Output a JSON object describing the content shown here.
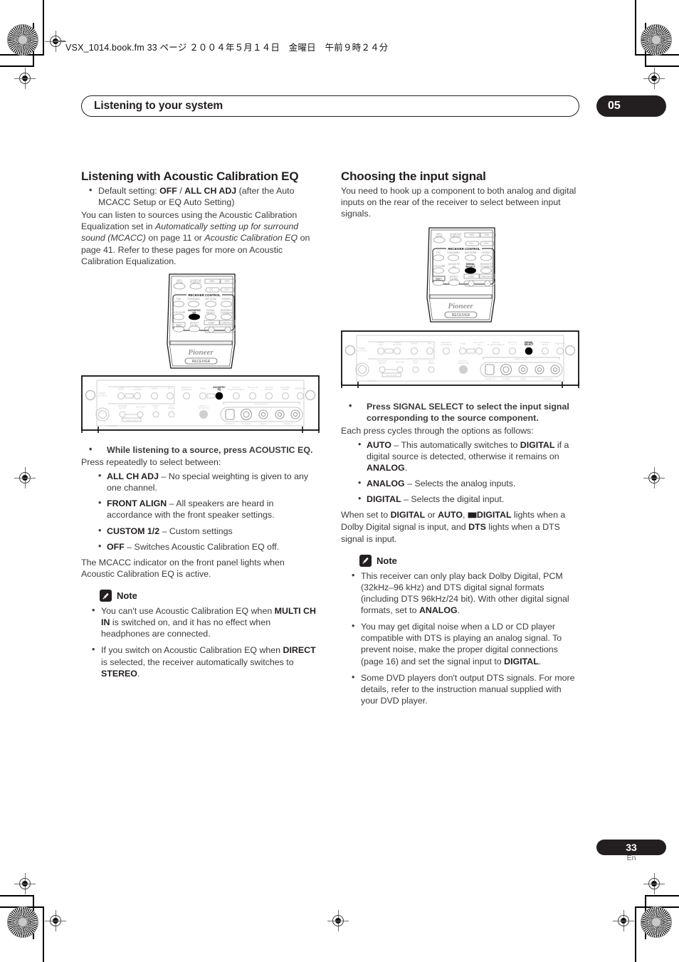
{
  "slug": "VSX_1014.book.fm 33 ページ ２００４年５月１４日　金曜日　午前９時２４分",
  "running_head": {
    "title": "Listening to your system",
    "chapter": "05"
  },
  "footer": {
    "page": "33",
    "lang": "En"
  },
  "left_column": {
    "heading": "Listening with Acoustic Calibration EQ",
    "default_setting": {
      "prefix": "Default setting: ",
      "value_a": "OFF",
      "sep": " / ",
      "value_b": "ALL CH ADJ",
      "suffix": " (after the Auto MCACC Setup or EQ Auto Setting)"
    },
    "intro_part1": "You can listen to sources using the Acoustic Calibration Equalization set in ",
    "intro_italic1": "Automatically setting up for surround sound (MCACC)",
    "intro_part2": " on page 11 or ",
    "intro_italic2": "Acoustic Calibration EQ",
    "intro_part3": " on page 41. Refer to these pages for more on Acoustic Calibration Equalization.",
    "step": "While listening to a source, press ACOUSTIC EQ.",
    "step_follow": "Press repeatedly to select between:",
    "options": [
      {
        "term": "ALL CH ADJ",
        "desc": " – No special weighting is given to any one channel."
      },
      {
        "term": "FRONT ALIGN",
        "desc": " – All speakers are heard in accordance with the front speaker settings."
      },
      {
        "term": "CUSTOM 1/2",
        "desc": " – Custom settings"
      },
      {
        "term": "OFF",
        "desc": " – Switches Acoustic Calibration EQ off."
      }
    ],
    "closing": "The MCACC indicator on the front panel lights when Acoustic Calibration EQ is active.",
    "note_label": "Note",
    "notes": [
      {
        "a": "You can't use Acoustic Calibration EQ when ",
        "b": "MULTI CH IN",
        "c": " is switched on, and it has no effect when headphones are connected."
      },
      {
        "a": "If you switch on Acoustic Calibration EQ when ",
        "b": "DIRECT",
        "c": " is selected, the receiver automatically switches to ",
        "d": "STEREO",
        "e": "."
      }
    ],
    "remote": {
      "section_label": "RECEIVER CONTROL",
      "highlighted_button": "ACOUSTIC EQ",
      "brand": "Pioneer",
      "mode_label": "RECEIVER",
      "top_row": [
        "MPX AUDIO",
        "CH SETUP SUBTITLE",
        "HDD",
        "DVD"
      ],
      "ch_buttons": [
        "CH –",
        "CH +"
      ],
      "row1": [
        "THX",
        "STANDARD",
        "ADV SURR",
        "STEREO"
      ],
      "row2": [
        "AUTO SURR",
        "ACOUSTIC EQ",
        "SIGNAL SELECT",
        "MIDNIGHT/ LOUDNESS"
      ],
      "row3": [
        "SHIFT",
        "EFFECT /CH SEL",
        "JUMP",
        "DIALOG E"
      ],
      "vol_buttons": [
        "–",
        "+"
      ]
    },
    "panel": {
      "highlighted_control": "ACOUSTIC EQ",
      "group_label": "TUNER CONTROL",
      "top_labels": [
        "TUNER EDIT",
        "TUNER STATION",
        "BAND",
        "MPX",
        "MIDNIGHT LOUDNESS",
        "TONE",
        "ACOUSTIC EQ",
        "DIALOG ENHANCEMENT",
        "MULTI CH IN",
        "SIGNAL SELECT",
        "STANDBY MODE",
        "SPEAKERS"
      ],
      "bottom_labels": [
        "SYSTEM SETUP",
        "RETURN",
        "INPUT ATT",
        "PL II MODE",
        "MULTI JOG",
        "MCACC SETUP MIC",
        "PHONES"
      ],
      "video_input_label": "VIDEO INPUT",
      "jack_labels": [
        "DIGITAL IN",
        "S-VIDEO",
        "VIDEO",
        "L   AUDIO   R"
      ]
    }
  },
  "right_column": {
    "heading": "Choosing the input signal",
    "intro": "You need to hook up a component to both analog and digital inputs on the rear of the receiver to select between input signals.",
    "step": "Press SIGNAL SELECT to select the input signal corresponding to the source component.",
    "step_follow": "Each press cycles through the options as follows:",
    "options": [
      {
        "term": "AUTO",
        "d1": " – This automatically switches to ",
        "b1": "DIGITAL",
        "d2": " if a digital source is detected, otherwise it remains on ",
        "b2": "ANALOG",
        "d3": "."
      },
      {
        "term": "ANALOG",
        "d1": " – Selects the analog inputs."
      },
      {
        "term": "DIGITAL",
        "d1": " – Selects the digital input."
      }
    ],
    "closing": {
      "a": "When set to ",
      "b": "DIGITAL",
      "c": " or ",
      "d": "AUTO",
      "e": ", ",
      "dolby_symbol": " ",
      "f": "DIGITAL",
      "g": " lights when a Dolby Digital signal is input, and ",
      "h": "DTS",
      "i": " lights when a DTS signal is input."
    },
    "note_label": "Note",
    "notes": [
      {
        "a": "This receiver can only play back Dolby Digital, PCM (32kHz–96 kHz) and DTS digital signal formats (including DTS 96kHz/24 bit). With other digital signal formats, set to ",
        "b": "ANALOG",
        "c": "."
      },
      {
        "a": "You may get digital noise when a LD or CD player compatible with DTS is playing an analog signal. To prevent noise, make the proper digital connections (page 16) and set the signal input to ",
        "b": "DIGITAL",
        "c": "."
      },
      {
        "a": "Some DVD players don't output DTS signals. For more details, refer to the instruction manual supplied with your DVD player."
      }
    ],
    "remote": {
      "section_label": "RECEIVER CONTROL",
      "highlighted_button": "SIGNAL SELECT",
      "brand": "Pioneer",
      "mode_label": "RECEIVER",
      "top_row": [
        "MPX AUDIO",
        "CH SETUP SUBTITLE",
        "HDD",
        "DVD"
      ],
      "ch_buttons": [
        "CH –",
        "CH +"
      ],
      "row1": [
        "THX",
        "STANDARD",
        "ADV SURR",
        "STEREO"
      ],
      "row2": [
        "AUTO SURR",
        "ACOUSTIC EQ",
        "SIGNAL SELECT",
        "MIDNIGHT/ LOUDNESS"
      ],
      "row3": [
        "SHIFT",
        "EFFECT /CH SEL",
        "JUMP",
        "DIALOG E"
      ],
      "vol_buttons": [
        "–",
        "+"
      ]
    },
    "panel": {
      "highlighted_control": "SIGNAL SELECT",
      "group_label": "TUNER CONTROL",
      "top_labels": [
        "TUNER EDIT",
        "TUNER STATION",
        "BAND",
        "MPX",
        "MIDNIGHT LOUDNESS",
        "TONE",
        "ACOUSTIC EQ",
        "DIALOG ENHANCEMENT",
        "MULTI CH IN",
        "SIGNAL SELECT",
        "STANDBY MODE",
        "SPEAKERS"
      ],
      "bottom_labels": [
        "SYSTEM SETUP",
        "RETURN",
        "INPUT ATT",
        "PL II MODE",
        "MULTI JOG",
        "MCACC SETUP MIC",
        "PHONES"
      ],
      "video_input_label": "VIDEO INPUT",
      "jack_labels": [
        "DIGITAL IN",
        "S-VIDEO",
        "VIDEO",
        "L   AUDIO   R"
      ]
    }
  }
}
